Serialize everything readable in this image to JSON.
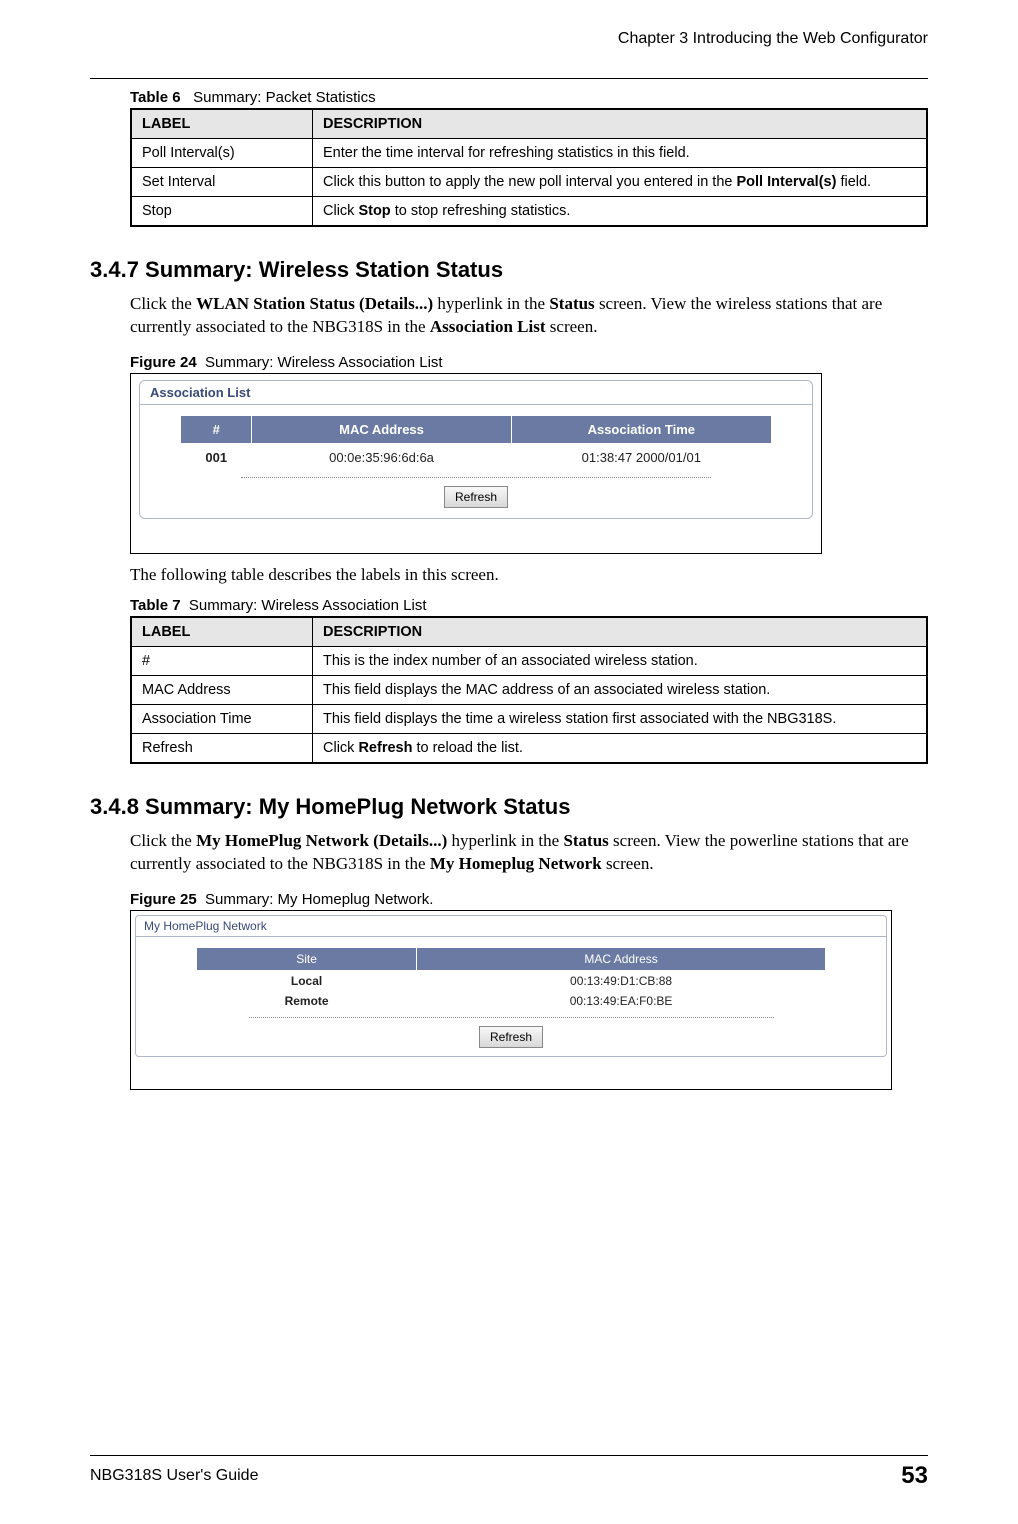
{
  "header": {
    "chapter": "Chapter 3 Introducing the Web Configurator"
  },
  "table6": {
    "caption_prefix": "Table 6",
    "caption_text": "Summary: Packet Statistics",
    "header_label": "LABEL",
    "header_desc": "DESCRIPTION",
    "rows": [
      {
        "label": "Poll Interval(s)",
        "desc": "Enter the time interval for refreshing statistics in this field."
      },
      {
        "label": "Set Interval",
        "desc_pre": "Click this button to apply the new poll interval you entered in the ",
        "desc_bold": "Poll Interval(s)",
        "desc_post": " field."
      },
      {
        "label": "Stop",
        "desc_pre": "Click ",
        "desc_bold": "Stop",
        "desc_post": " to stop refreshing statistics."
      }
    ]
  },
  "section347": {
    "title": "3.4.7  Summary: Wireless Station Status",
    "para_parts": {
      "p1": "Click the ",
      "b1": "WLAN Station Status (Details...)",
      "p2": " hyperlink in the ",
      "b2": "Status",
      "p3": " screen. View the wireless stations that are currently associated to the NBG318S in the ",
      "b3": "Association List",
      "p4": " screen."
    }
  },
  "figure24": {
    "caption_prefix": "Figure 24",
    "caption_text": "Summary: Wireless Association List",
    "panel_title": "Association List",
    "cols": {
      "idx": "#",
      "mac": "MAC Address",
      "assoc": "Association Time"
    },
    "row": {
      "idx": "001",
      "mac": "00:0e:35:96:6d:6a",
      "assoc": "01:38:47 2000/01/01"
    },
    "refresh_btn": "Refresh"
  },
  "table7_intro": "The following table describes the labels in this screen.",
  "table7": {
    "caption_prefix": "Table 7",
    "caption_text": "Summary: Wireless Association List",
    "header_label": "LABEL",
    "header_desc": "DESCRIPTION",
    "rows": [
      {
        "label": "#",
        "desc": "This is the index number of an associated wireless station."
      },
      {
        "label": "MAC Address",
        "desc": "This field displays the MAC address of an associated wireless station."
      },
      {
        "label": "Association Time",
        "desc": "This field displays the time a wireless station first associated with the NBG318S."
      },
      {
        "label": "Refresh",
        "desc_pre": "Click ",
        "desc_bold": "Refresh",
        "desc_post": " to reload the list."
      }
    ]
  },
  "section348": {
    "title": "3.4.8  Summary: My HomePlug Network Status",
    "para_parts": {
      "p1": "Click the ",
      "b1": "My HomePlug Network (Details...)",
      "p2": " hyperlink in the ",
      "b2": "Status",
      "p3": " screen. View the powerline stations that are currently associated to the NBG318S in the ",
      "b3": "My Homeplug Network",
      "p4": " screen."
    }
  },
  "figure25": {
    "caption_prefix": "Figure 25",
    "caption_text": "Summary: My Homeplug Network.",
    "panel_title": "My HomePlug Network",
    "cols": {
      "site": "Site",
      "mac": "MAC Address"
    },
    "rows": [
      {
        "site": "Local",
        "mac": "00:13:49:D1:CB:88"
      },
      {
        "site": "Remote",
        "mac": "00:13:49:EA:F0:BE"
      }
    ],
    "refresh_btn": "Refresh"
  },
  "footer": {
    "guide": "NBG318S User's Guide",
    "page": "53"
  }
}
